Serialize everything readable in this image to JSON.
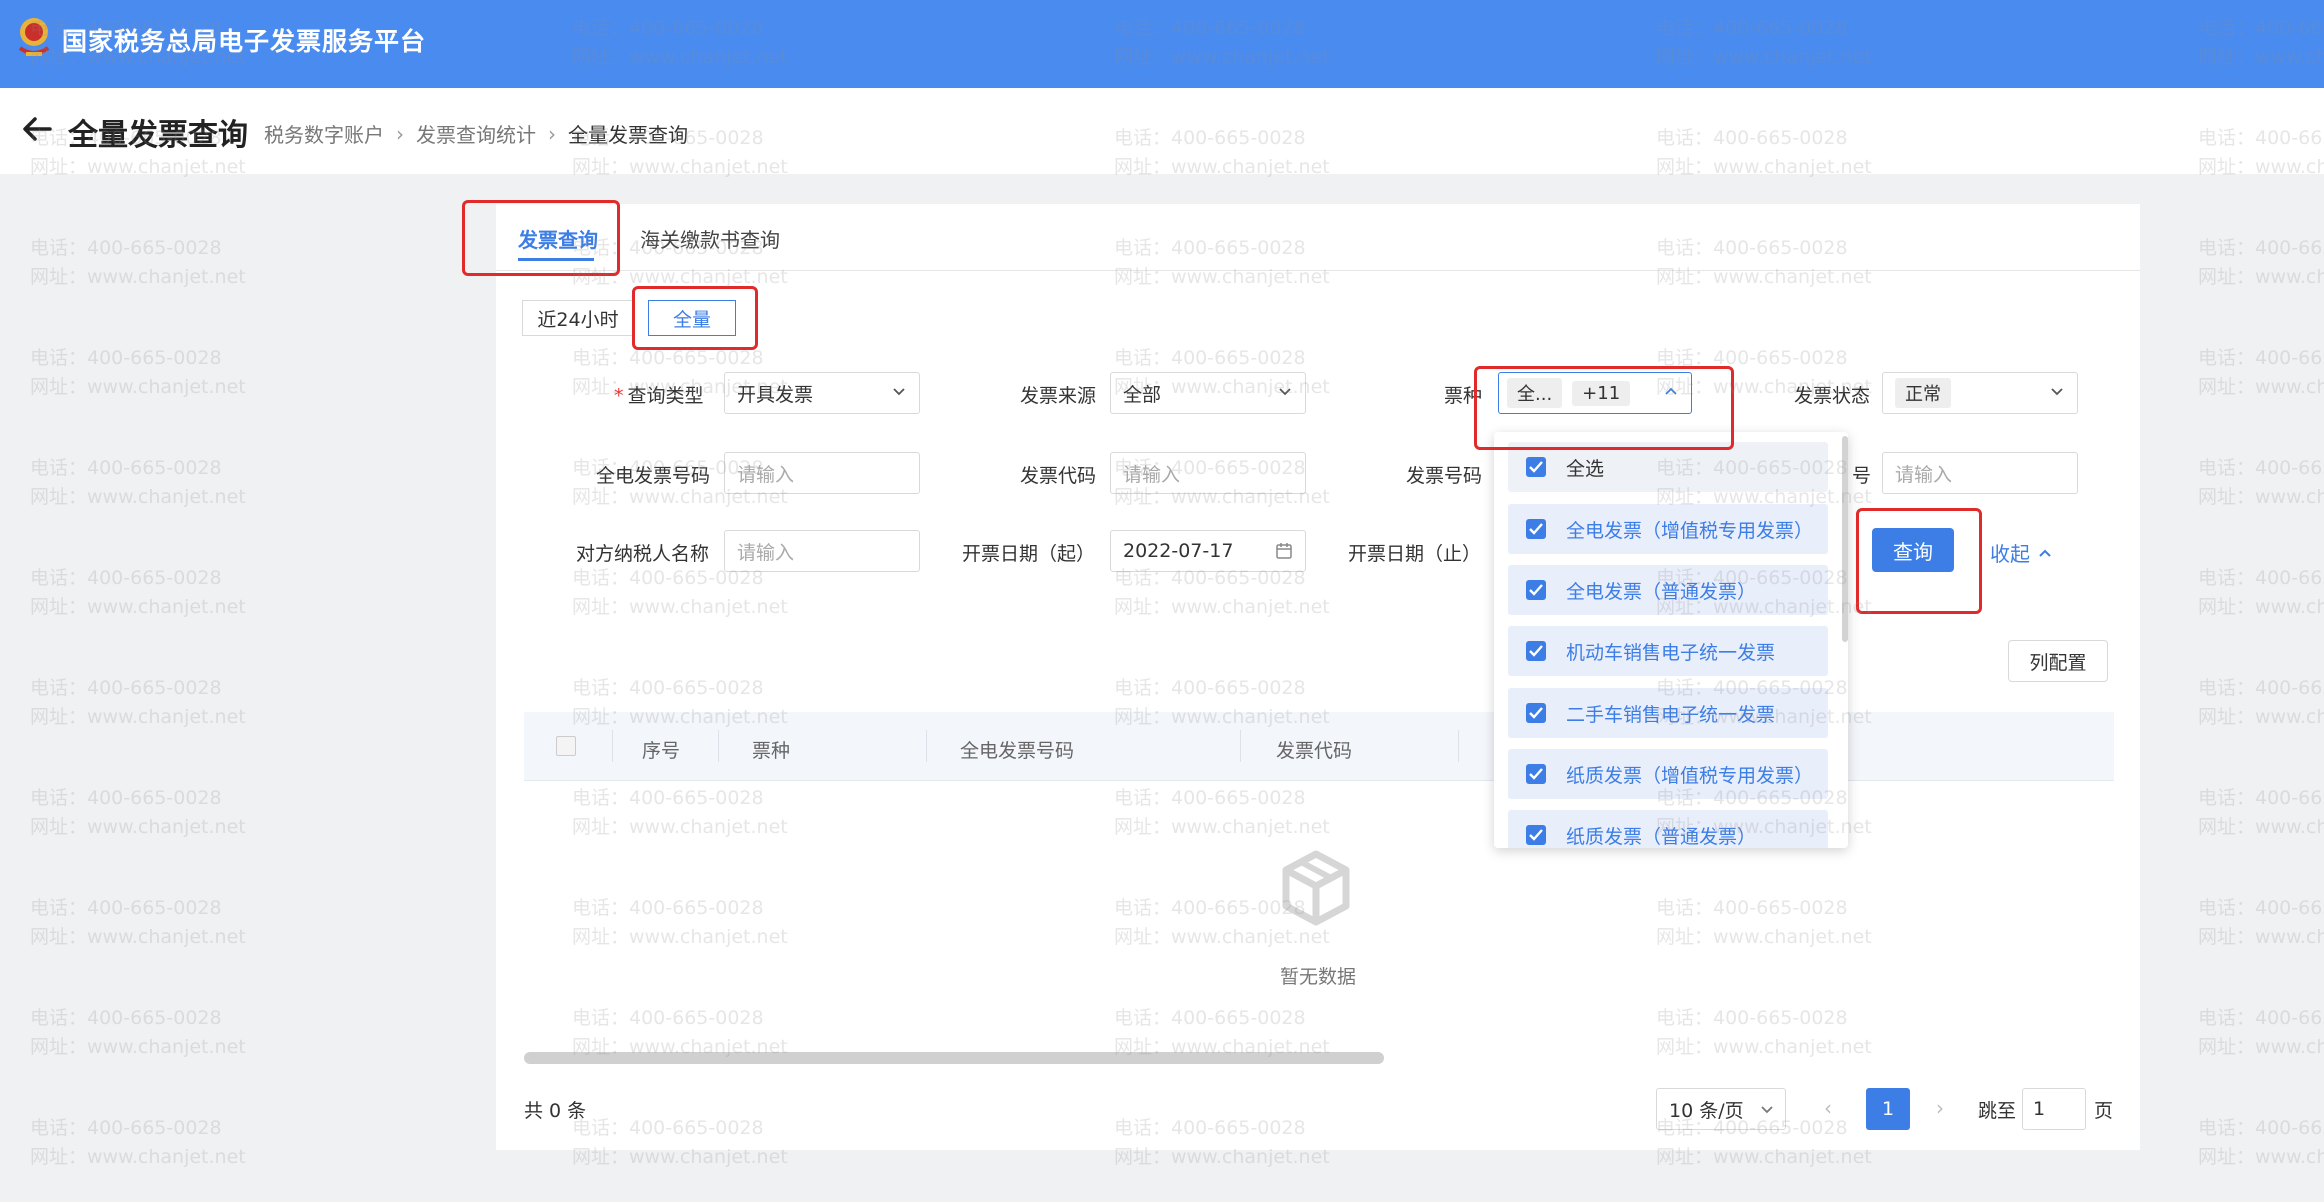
{
  "header": {
    "app_title": "国家税务总局电子发票服务平台"
  },
  "subheader": {
    "page_title": "全量发票查询",
    "breadcrumb": [
      "税务数字账户",
      "发票查询统计",
      "全量发票查询"
    ]
  },
  "tabs": [
    {
      "label": "发票查询",
      "active": true
    },
    {
      "label": "海关缴款书查询",
      "active": false
    }
  ],
  "time_range": [
    {
      "label": "近24小时",
      "active": false
    },
    {
      "label": "全量",
      "active": true
    }
  ],
  "filters": {
    "query_type": {
      "label": "查询类型",
      "value": "开具发票",
      "required_mark": "*"
    },
    "invoice_source": {
      "label": "发票来源",
      "value": "全部"
    },
    "invoice_kind": {
      "label": "票种",
      "tag": "全...",
      "more": "+11"
    },
    "invoice_status": {
      "label": "发票状态",
      "value": "正常"
    },
    "full_invoice_no": {
      "label": "全电发票号码",
      "placeholder": "请输入"
    },
    "invoice_code": {
      "label": "发票代码",
      "placeholder": "请输入"
    },
    "invoice_no": {
      "label": "发票号码"
    },
    "partial_label_suffix": "号",
    "partial_placeholder": "请输入",
    "counterparty": {
      "label": "对方纳税人名称",
      "placeholder": "请输入"
    },
    "date_start": {
      "label": "开票日期（起）",
      "value": "2022-07-17"
    },
    "date_end": {
      "label": "开票日期（止）"
    }
  },
  "actions": {
    "query": "查询",
    "collapse": "收起",
    "column_config": "列配置"
  },
  "dropdown_options": [
    "全选",
    "全电发票（增值税专用发票）",
    "全电发票（普通发票）",
    "机动车销售电子统一发票",
    "二手车销售电子统一发票",
    "纸质发票（增值税专用发票）",
    "纸质发票（普通发票）"
  ],
  "table": {
    "columns": [
      "序号",
      "票种",
      "全电发票号码",
      "发票代码"
    ],
    "empty_text": "暂无数据"
  },
  "pagination": {
    "total": "共 0 条",
    "page_size": "10 条/页",
    "prev": "‹",
    "current_page": "1",
    "next": "›",
    "jump_label": "跳至",
    "jump_value": "1",
    "jump_unit": "页"
  },
  "watermark": {
    "phone": "电话：400-665-0028",
    "site": "网址：www.chanjet.net"
  },
  "colors": {
    "header": "#4a8bf0",
    "primary": "#3d7ee6",
    "highlight": "#e12a2a"
  }
}
